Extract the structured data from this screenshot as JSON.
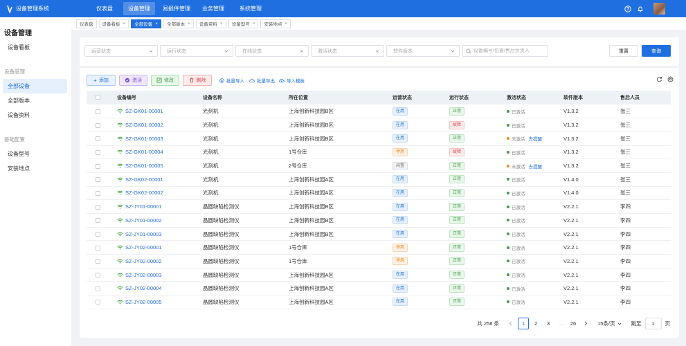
{
  "app": {
    "title": "设备管理系统"
  },
  "topnav": [
    {
      "label": "仪表盘",
      "active": false
    },
    {
      "label": "设备管理",
      "active": true
    },
    {
      "label": "易损件管理",
      "active": false
    },
    {
      "label": "业务管理",
      "active": false
    },
    {
      "label": "系统管理",
      "active": false
    }
  ],
  "sidebar": {
    "title": "设备管理",
    "top_item": "设备看板",
    "group1": "设备管理",
    "group1_items": [
      {
        "label": "全部设备",
        "active": true
      },
      {
        "label": "全部版本",
        "active": false
      },
      {
        "label": "设备资料",
        "active": false
      }
    ],
    "group2": "基础配置",
    "group2_items": [
      {
        "label": "设备型号",
        "active": false
      },
      {
        "label": "安装地点",
        "active": false
      }
    ]
  },
  "tabs": [
    {
      "label": "仪表盘",
      "closable": false,
      "active": false
    },
    {
      "label": "设备看板",
      "closable": true,
      "active": false
    },
    {
      "label": "全部设备",
      "closable": true,
      "active": true
    },
    {
      "label": "全部版本",
      "closable": true,
      "active": false
    },
    {
      "label": "设备资料",
      "closable": true,
      "active": false
    },
    {
      "label": "设备型号",
      "closable": true,
      "active": false
    },
    {
      "label": "安装地点",
      "closable": true,
      "active": false
    }
  ],
  "filters": {
    "op_status": "运营状态",
    "run_status": "运行状态",
    "online_status": "在线状态",
    "activation_status": "激活状态",
    "software_version": "软件版本",
    "search_placeholder": "设备编号/位置/售后负责人",
    "reset": "重置",
    "query": "查询"
  },
  "actions": {
    "add": "添加",
    "activate": "激活",
    "modify": "修改",
    "delete": "删除",
    "batch_import": "批量导入",
    "batch_export": "批量导出",
    "import_template": "导入模板"
  },
  "table": {
    "headers": [
      "设备编号",
      "设备名称",
      "所在位置",
      "运营状态",
      "运行状态",
      "激活状态",
      "软件版本",
      "售后人员"
    ],
    "remind_label": "去提醒",
    "rows": [
      {
        "code": "SZ-GK01-00001",
        "name": "光刻机",
        "location": "上海创新科技园B区",
        "op": "在用",
        "op_color": "blue",
        "run": "正常",
        "run_color": "green",
        "act": "已激活",
        "activated": true,
        "version": "V1.3.2",
        "staff": "张三"
      },
      {
        "code": "SZ-GK01-00002",
        "name": "光刻机",
        "location": "上海创新科技园B区",
        "op": "在用",
        "op_color": "blue",
        "run": "故障",
        "run_color": "red",
        "act": "已激活",
        "activated": true,
        "version": "V1.3.2",
        "staff": "张三"
      },
      {
        "code": "SZ-GK01-00003",
        "name": "光刻机",
        "location": "上海创新科技园B区",
        "op": "在用",
        "op_color": "blue",
        "run": "正常",
        "run_color": "green",
        "act": "未激活",
        "activated": false,
        "version": "V1.3.2",
        "staff": "张三"
      },
      {
        "code": "SZ-GK01-00004",
        "name": "光刻机",
        "location": "1号仓库",
        "op": "停用",
        "op_color": "orange",
        "run": "故障",
        "run_color": "red",
        "act": "已激活",
        "activated": true,
        "version": "V1.3.2",
        "staff": "张三"
      },
      {
        "code": "SZ-GK01-00005",
        "name": "光刻机",
        "location": "2号仓库",
        "op": "闲置",
        "op_color": "gray",
        "run": "正常",
        "run_color": "green",
        "act": "未激活",
        "activated": false,
        "version": "V1.3.2",
        "staff": "张三"
      },
      {
        "code": "SZ-GK02-00001",
        "name": "光刻机",
        "location": "上海创新科技园A区",
        "op": "在用",
        "op_color": "blue",
        "run": "正常",
        "run_color": "green",
        "act": "已激活",
        "activated": true,
        "version": "V1.4.0",
        "staff": "张三"
      },
      {
        "code": "SZ-GK02-00002",
        "name": "光刻机",
        "location": "上海创新科技园A区",
        "op": "在用",
        "op_color": "blue",
        "run": "正常",
        "run_color": "green",
        "act": "已激活",
        "activated": true,
        "version": "V1.4.0",
        "staff": "张三"
      },
      {
        "code": "SZ-JY01-00001",
        "name": "晶圆缺陷检测仪",
        "location": "上海创新科技园B区",
        "op": "在用",
        "op_color": "blue",
        "run": "正常",
        "run_color": "green",
        "act": "已激活",
        "activated": true,
        "version": "V2.2.1",
        "staff": "李四"
      },
      {
        "code": "SZ-JY01-00002",
        "name": "晶圆缺陷检测仪",
        "location": "上海创新科技园B区",
        "op": "在用",
        "op_color": "blue",
        "run": "正常",
        "run_color": "green",
        "act": "已激活",
        "activated": true,
        "version": "V2.2.1",
        "staff": "李四"
      },
      {
        "code": "SZ-JY01-00003",
        "name": "晶圆缺陷检测仪",
        "location": "上海创新科技园B区",
        "op": "在用",
        "op_color": "blue",
        "run": "正常",
        "run_color": "green",
        "act": "已激活",
        "activated": true,
        "version": "V2.2.1",
        "staff": "李四"
      },
      {
        "code": "SZ-JY02-00001",
        "name": "晶圆缺陷检测仪",
        "location": "1号仓库",
        "op": "停用",
        "op_color": "orange",
        "run": "正常",
        "run_color": "green",
        "act": "已激活",
        "activated": true,
        "version": "V2.2.1",
        "staff": "李四"
      },
      {
        "code": "SZ-JY02-00002",
        "name": "晶圆缺陷检测仪",
        "location": "1号仓库",
        "op": "停用",
        "op_color": "orange",
        "run": "正常",
        "run_color": "green",
        "act": "已激活",
        "activated": true,
        "version": "V2.2.1",
        "staff": "李四"
      },
      {
        "code": "SZ-JY02-00003",
        "name": "晶圆缺陷检测仪",
        "location": "上海创新科技园A区",
        "op": "在用",
        "op_color": "blue",
        "run": "正常",
        "run_color": "green",
        "act": "已激活",
        "activated": true,
        "version": "V2.2.1",
        "staff": "李四"
      },
      {
        "code": "SZ-JY02-00004",
        "name": "晶圆缺陷检测仪",
        "location": "上海创新科技园A区",
        "op": "在用",
        "op_color": "blue",
        "run": "正常",
        "run_color": "green",
        "act": "已激活",
        "activated": true,
        "version": "V2.2.1",
        "staff": "李四"
      },
      {
        "code": "SZ-JY02-00005",
        "name": "晶圆缺陷检测仪",
        "location": "上海创新科技园A区",
        "op": "在用",
        "op_color": "blue",
        "run": "正常",
        "run_color": "green",
        "act": "已激活",
        "activated": true,
        "version": "V2.2.1",
        "staff": "李四"
      }
    ]
  },
  "pagination": {
    "total": "共 258 条",
    "pages": [
      "1",
      "2",
      "3",
      "...",
      "26"
    ],
    "current": "1",
    "page_size": "15条/页",
    "goto_label": "跳至",
    "goto_value": "1",
    "page_unit": "页"
  },
  "colors": {
    "primary": "#1f6fe0"
  }
}
